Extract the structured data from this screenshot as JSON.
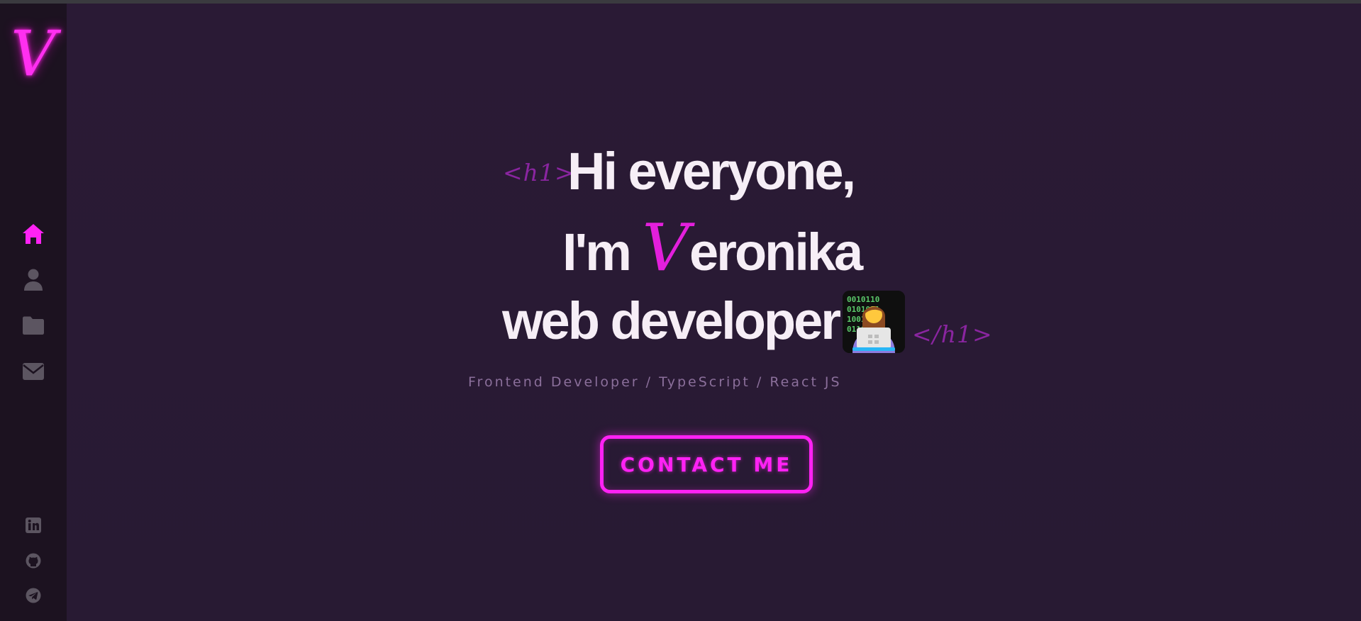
{
  "sidebar": {
    "logo_letter": "V",
    "nav": [
      {
        "name": "home",
        "icon": "home-icon",
        "active": true
      },
      {
        "name": "about",
        "icon": "user-icon",
        "active": false
      },
      {
        "name": "projects",
        "icon": "folder-icon",
        "active": false
      },
      {
        "name": "contact",
        "icon": "envelope-icon",
        "active": false
      }
    ],
    "social": [
      {
        "name": "linkedin",
        "icon": "linkedin-icon"
      },
      {
        "name": "github",
        "icon": "github-icon"
      },
      {
        "name": "telegram",
        "icon": "telegram-icon"
      }
    ]
  },
  "hero": {
    "open_tag": "<h1>",
    "close_tag": "</h1>",
    "line1": "Hi everyone,",
    "line2_prefix": "I'm",
    "line2_initial": "V",
    "line2_rest": "eronika",
    "line3": "web developer",
    "emoji_name": "woman-technologist-icon",
    "subtitle": "Frontend Developer / TypeScript / React JS",
    "contact_button": "CONTACT ME"
  },
  "colors": {
    "accent": "#ff22f4",
    "background": "#2a1a34",
    "sidebar": "#1c1220",
    "icon_muted": "#5c5561"
  }
}
